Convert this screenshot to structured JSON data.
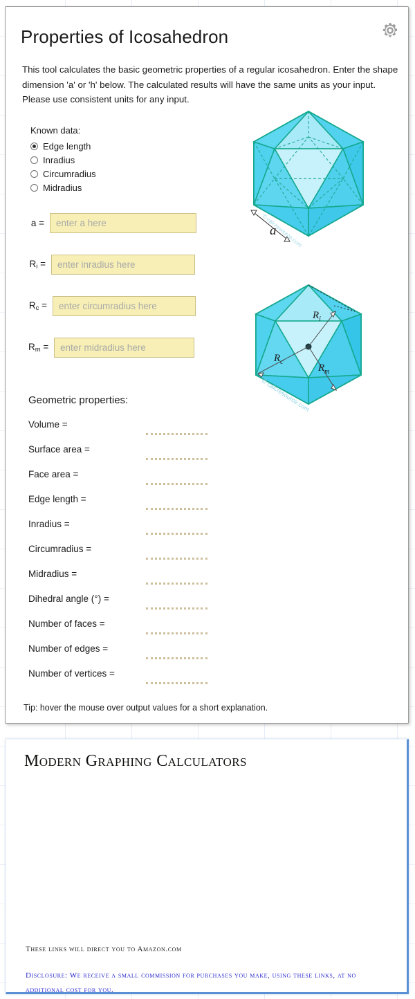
{
  "page": {
    "background": "#ffffff",
    "grid_color": "#c8d6eb"
  },
  "calculator": {
    "title": "Properties of Icosahedron",
    "settings_icon": "gear-icon",
    "intro": "This tool calculates the basic geometric properties of a regular icosahedron. Enter the shape dimension 'a' or 'h' below. The calculated results will have the same units as your input. Please use consistent units for any input.",
    "known_data_label": "Known data:",
    "radio_options": [
      {
        "label": "Edge length",
        "selected": true
      },
      {
        "label": "Inradius",
        "selected": false
      },
      {
        "label": "Circumradius",
        "selected": false
      },
      {
        "label": "Midradius",
        "selected": false
      }
    ],
    "inputs": [
      {
        "label": "a =",
        "sym": "a",
        "sub": "",
        "value": "",
        "placeholder": "enter a here"
      },
      {
        "label": "R",
        "sym": "R",
        "sub": "i",
        "value": "",
        "placeholder": "enter inradius here"
      },
      {
        "label": "R",
        "sym": "R",
        "sub": "c",
        "value": "",
        "placeholder": "enter circumradius here"
      },
      {
        "label": "R",
        "sym": "R",
        "sub": "m",
        "value": "",
        "placeholder": "enter midradius here"
      }
    ],
    "results_title": "Geometric properties:",
    "results": [
      {
        "label": "Volume =",
        "value": ""
      },
      {
        "label": "Surface area =",
        "value": ""
      },
      {
        "label": "Face area =",
        "value": ""
      },
      {
        "label": "Edge length =",
        "value": ""
      },
      {
        "label": "Inradius =",
        "value": ""
      },
      {
        "label": "Circumradius =",
        "value": ""
      },
      {
        "label": "Midradius =",
        "value": ""
      },
      {
        "label": "Dihedral angle (°) =",
        "value": ""
      },
      {
        "label": "Number of faces =",
        "value": ""
      },
      {
        "label": "Number of edges =",
        "value": ""
      },
      {
        "label": "Number of vertices =",
        "value": ""
      }
    ],
    "tip": "Tip: hover the mouse over output values for a short explanation.",
    "figures": {
      "figure1": {
        "name": "icosahedron-edge-diagram",
        "dimension_label": "a",
        "watermark": "© calcresource.com"
      },
      "figure2": {
        "name": "icosahedron-radii-diagram",
        "labels": {
          "inradius": "R",
          "inradius_sub": "i",
          "circumradius": "R",
          "circumradius_sub": "c",
          "midradius": "R",
          "midradius_sub": "m"
        },
        "watermark": "© calcresource.com"
      }
    },
    "colors": {
      "input_bg": "#f7efb5",
      "input_border": "#cbbf86",
      "dotted_value": "#cdbf9b",
      "shape_fill": "#46d4ef",
      "shape_stroke": "#17a98c"
    }
  },
  "ad_panel": {
    "title": "Modern Graphing Calculators",
    "note": "These links will direct you to Amazon.com",
    "disclosure": "Disclosure: We receive a small commission for purchases you make, using these links, at no additional cost for you.",
    "accent_color": "#5b8fd4",
    "disclosure_color": "#2a2ad0"
  }
}
